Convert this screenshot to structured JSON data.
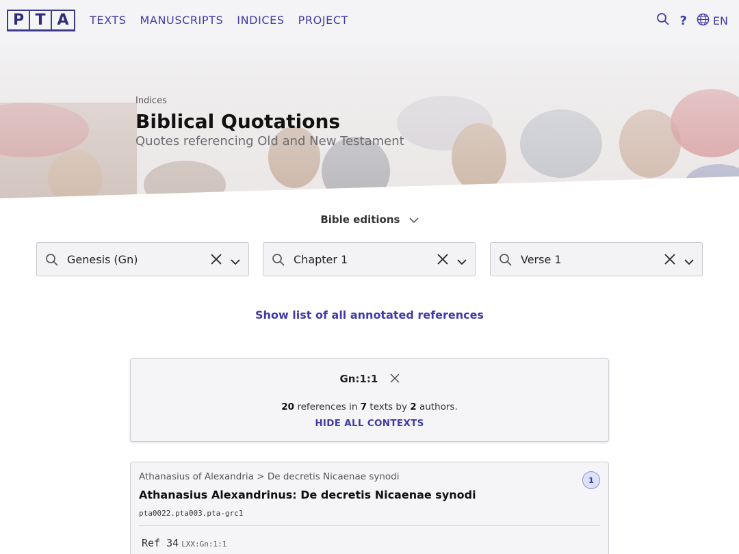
{
  "logo": {
    "letters": [
      "P",
      "T",
      "A"
    ]
  },
  "nav": {
    "items": [
      "TEXTS",
      "MANUSCRIPTS",
      "INDICES",
      "PROJECT"
    ]
  },
  "header_right": {
    "help": "?",
    "language": "EN"
  },
  "hero": {
    "breadcrumb": "Indices",
    "title": "Biblical Quotations",
    "subtitle": "Quotes referencing Old and New Testament"
  },
  "editions": {
    "label": "Bible editions"
  },
  "selects": [
    {
      "value": "Genesis (Gn)"
    },
    {
      "value": "Chapter 1"
    },
    {
      "value": "Verse 1"
    }
  ],
  "show_all_link": "Show list of all annotated references",
  "summary": {
    "reference": "Gn:1:1",
    "ref_count": "20",
    "text_refs": " references in ",
    "text_count": "7",
    "text_texts": " texts by ",
    "author_count": "2",
    "text_authors": " authors.",
    "hide_label": "HIDE ALL CONTEXTS"
  },
  "result": {
    "path": "Athanasius of Alexandria > De decretis Nicaenae synodi",
    "badge": "1",
    "title": "Athanasius Alexandrinus: De decretis Nicaenae synodi",
    "urn": "pta0022.pta003.pta-grc1",
    "ref_label": "Ref 34",
    "ref_tag": "LXX:Gn:1:1"
  },
  "colors": {
    "accent": "#3f3aaa",
    "topbar": "#f4f4f6"
  }
}
